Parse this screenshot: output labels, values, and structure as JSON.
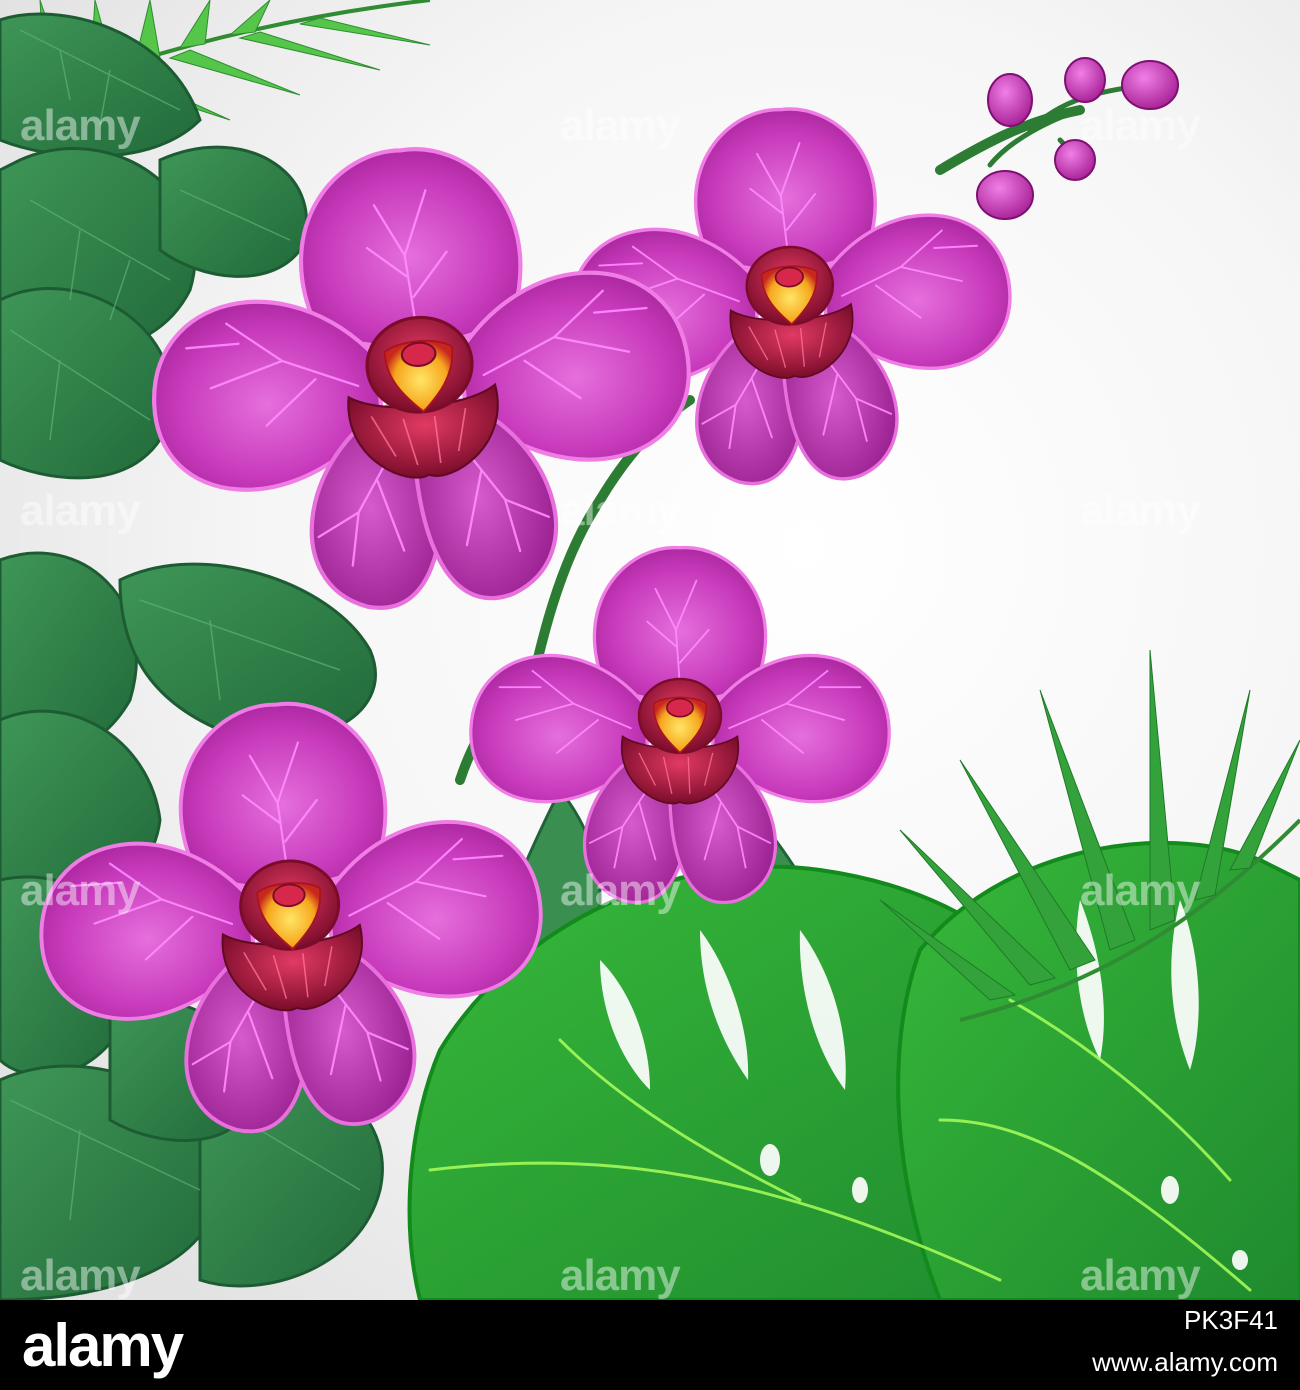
{
  "watermark": {
    "text": "alamy"
  },
  "footer": {
    "brand": "alamy",
    "image_id": "PK3F41",
    "url": "www.alamy.com"
  },
  "colors": {
    "background_light": "#ffffff",
    "background_gray": "#e2e2e2",
    "leaf_dark": "#2f7a47",
    "leaf_mid": "#3e9a55",
    "leaf_bright": "#5cc83c",
    "monstera": "#2ea82a",
    "petal_light": "#e06ad6",
    "petal_dark": "#a21f95",
    "vein": "#ff88ff",
    "lip": "#b0183f",
    "column": "#ffd21e",
    "footer_bg": "#000000",
    "footer_text": "#ffffff"
  }
}
